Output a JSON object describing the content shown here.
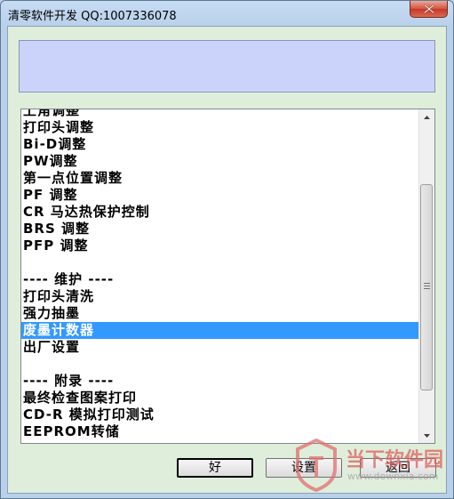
{
  "window": {
    "title": "清零软件开发 QQ:1007336078"
  },
  "info_box": {
    "text": ""
  },
  "list": {
    "items": [
      {
        "label": "上角调整"
      },
      {
        "label": "打印头调整"
      },
      {
        "label": "Bi-D调整"
      },
      {
        "label": "PW调整"
      },
      {
        "label": "第一点位置调整"
      },
      {
        "label": "PF 调整"
      },
      {
        "label": "CR 马达热保护控制"
      },
      {
        "label": "BRS 调整"
      },
      {
        "label": "PFP 调整"
      },
      {
        "label": ""
      },
      {
        "label": "---- 维护 ----"
      },
      {
        "label": "打印头清洗"
      },
      {
        "label": "强力抽墨"
      },
      {
        "label": "废墨计数器",
        "selected": true
      },
      {
        "label": "出厂设置"
      },
      {
        "label": ""
      },
      {
        "label": "---- 附录 ----"
      },
      {
        "label": "最终检查图案打印"
      },
      {
        "label": "CD-R 模拟打印测试"
      },
      {
        "label": "EEPROM转储"
      }
    ]
  },
  "buttons": {
    "ok_label": "好",
    "settings_label": "设置",
    "back_label": "返回"
  },
  "watermark": {
    "text": "当下软件园",
    "sub": "www.downxia.com"
  },
  "colors": {
    "client_bg": "#dfeedb",
    "info_bg": "#ccd3fb",
    "selection": "#3399ff"
  }
}
